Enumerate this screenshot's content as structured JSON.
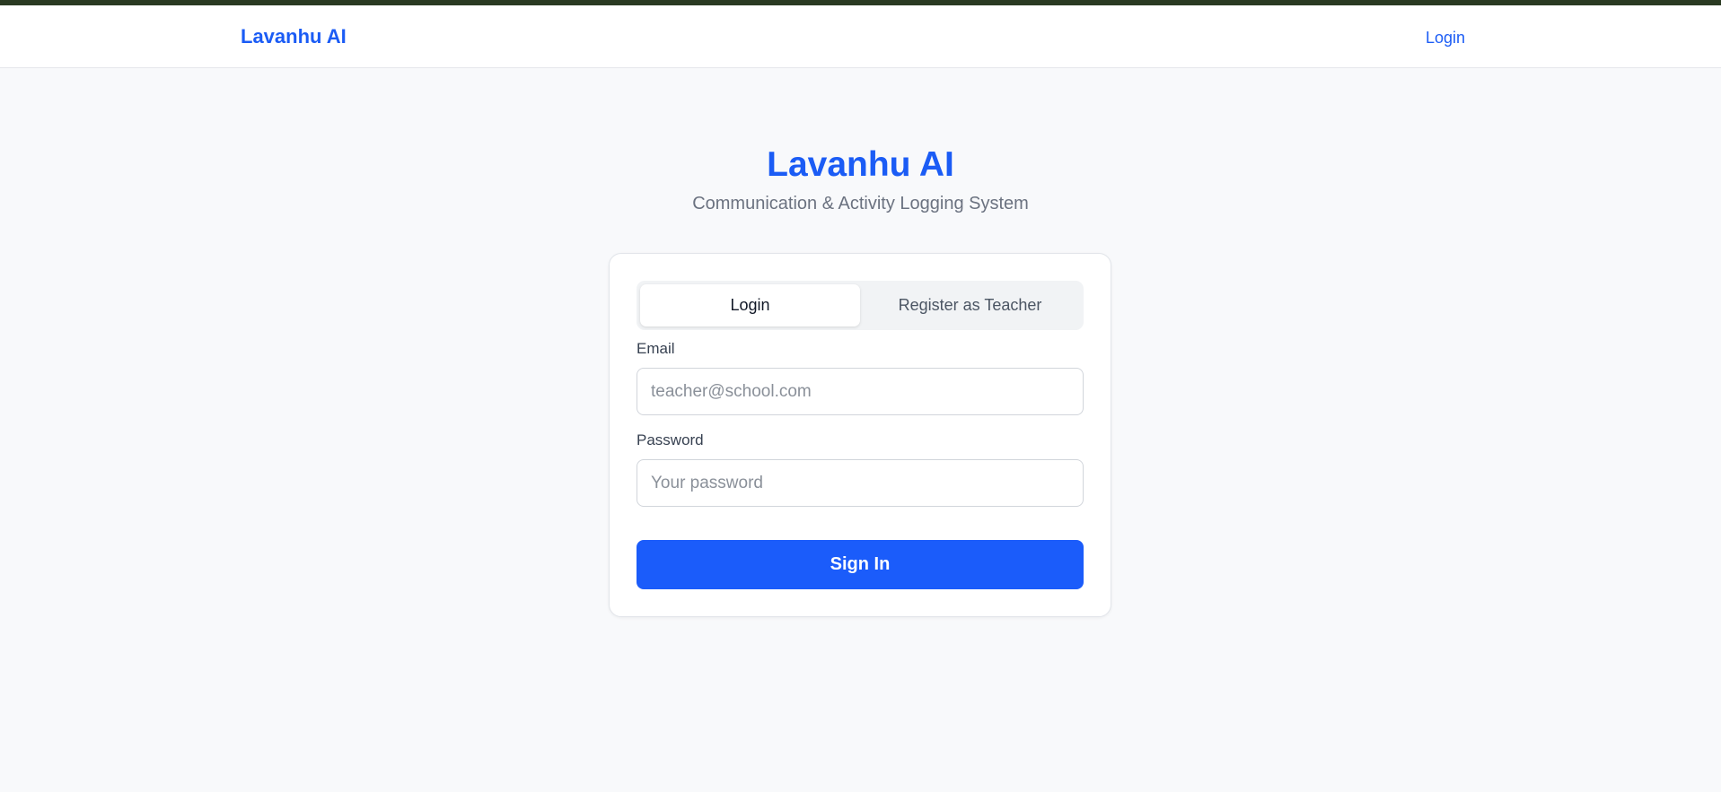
{
  "navbar": {
    "brand": "Lavanhu AI",
    "login_link": "Login"
  },
  "hero": {
    "title": "Lavanhu AI",
    "subtitle": "Communication & Activity Logging System"
  },
  "auth_card": {
    "tabs": [
      {
        "label": "Login",
        "active": true
      },
      {
        "label": "Register as Teacher",
        "active": false
      }
    ],
    "email": {
      "label": "Email",
      "value": "",
      "placeholder": "teacher@school.com"
    },
    "password": {
      "label": "Password",
      "value": "",
      "placeholder": "Your password"
    },
    "submit_label": "Sign In"
  },
  "colors": {
    "brand_blue": "#1b5cf5",
    "top_strip": "#2a3a22",
    "page_background": "#f8f9fb"
  }
}
